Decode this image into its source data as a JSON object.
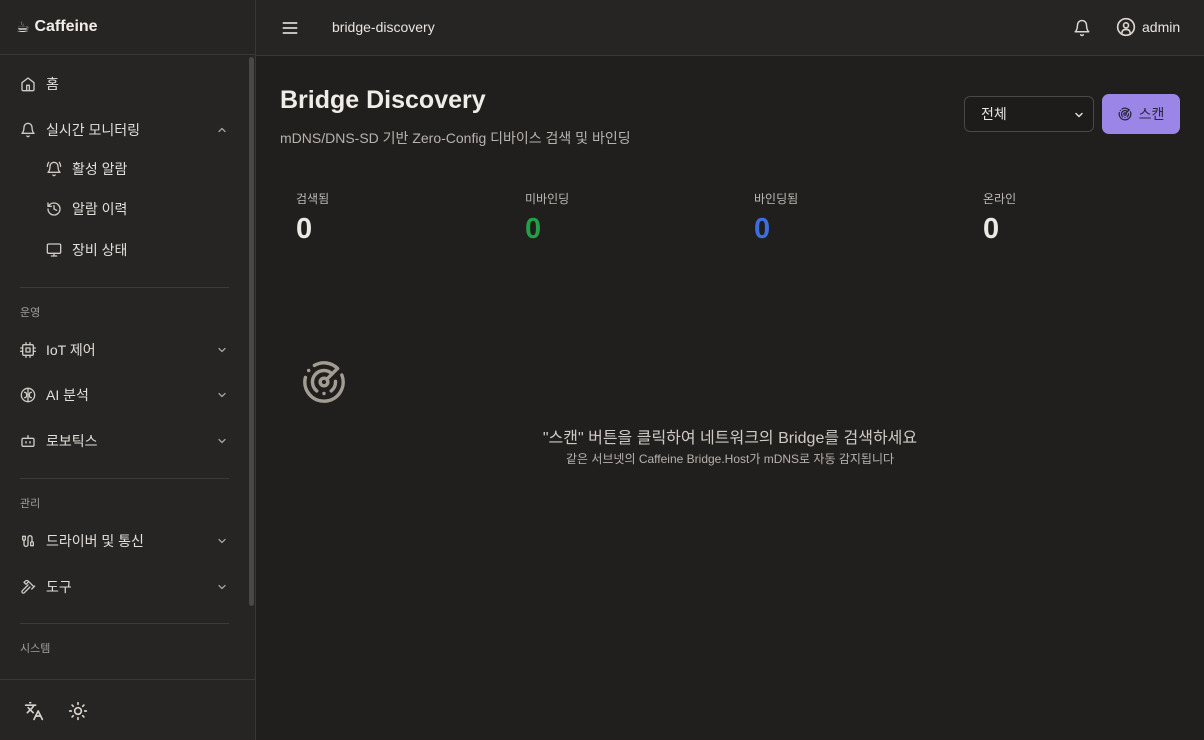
{
  "app": {
    "brand": "Caffeine",
    "brand_icon": "coffee-icon"
  },
  "sidebar": {
    "home": "홈",
    "monitoring": "실시간 모니터링",
    "monitoring_children": [
      "활성 알람",
      "알람 이력",
      "장비 상태"
    ],
    "sections": {
      "ops": "운영",
      "manage": "관리",
      "system": "시스템"
    },
    "ops_items": [
      "IoT 제어",
      "AI 분석",
      "로보틱스"
    ],
    "manage_items": [
      "드라이버 및 통신",
      "도구"
    ]
  },
  "topbar": {
    "breadcrumb": "bridge-discovery",
    "user": "admin"
  },
  "main": {
    "title": "Bridge Discovery",
    "subtitle": "mDNS/DNS-SD 기반 Zero-Config 디바이스 검색 및 바인딩",
    "filter_value": "전체",
    "scan_label": "스캔",
    "stats": [
      {
        "label": "검색됨",
        "value": "0",
        "color": "#ece8e3"
      },
      {
        "label": "미바인딩",
        "value": "0",
        "color": "#22a046"
      },
      {
        "label": "바인딩됨",
        "value": "0",
        "color": "#3b6fe0"
      },
      {
        "label": "온라인",
        "value": "0",
        "color": "#ece8e3"
      }
    ],
    "empty_title": "\"스캔\" 버튼을 클릭하여 네트워크의 Bridge를 검색하세요",
    "empty_sub": "같은 서브넷의 Caffeine Bridge.Host가 mDNS로 자동 감지됩니다"
  }
}
